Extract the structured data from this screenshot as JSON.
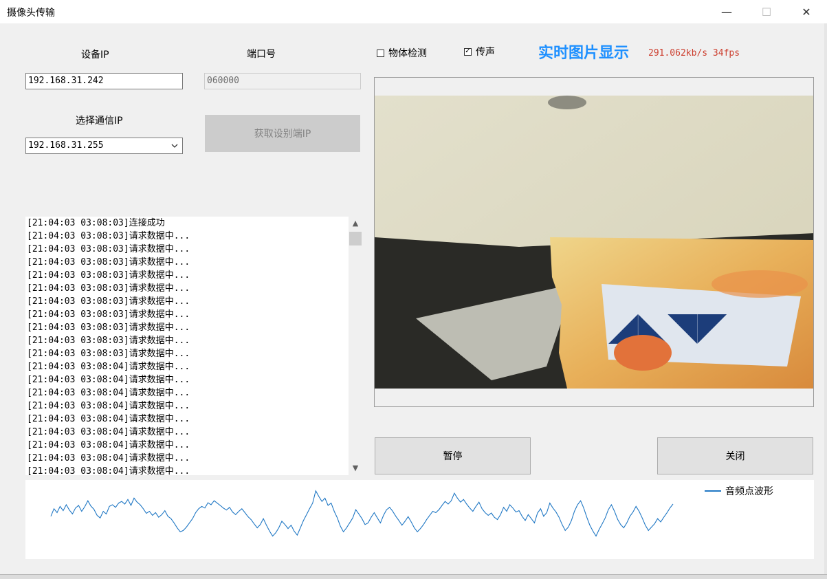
{
  "window": {
    "title": "摄像头传输",
    "minimize": "—",
    "maximize": "☐",
    "close": "✕"
  },
  "form": {
    "device_ip_label": "设备IP",
    "device_ip_value": "192.168.31.242",
    "port_label": "端口号",
    "port_value": "060000",
    "comm_ip_label": "选择通信IP",
    "comm_ip_value": "192.168.31.255",
    "get_ip_button": "获取设别端IP"
  },
  "options": {
    "object_detect_label": "物体检测",
    "object_detect_checked": false,
    "audio_label": "传声",
    "audio_checked": true
  },
  "display": {
    "title": "实时图片显示",
    "rate": "291.062kb/s 34fps"
  },
  "log": [
    "[21:04:03 03:08:03]连接成功",
    "[21:04:03 03:08:03]请求数据中...",
    "[21:04:03 03:08:03]请求数据中...",
    "[21:04:03 03:08:03]请求数据中...",
    "[21:04:03 03:08:03]请求数据中...",
    "[21:04:03 03:08:03]请求数据中...",
    "[21:04:03 03:08:03]请求数据中...",
    "[21:04:03 03:08:03]请求数据中...",
    "[21:04:03 03:08:03]请求数据中...",
    "[21:04:03 03:08:03]请求数据中...",
    "[21:04:03 03:08:03]请求数据中...",
    "[21:04:03 03:08:04]请求数据中...",
    "[21:04:03 03:08:04]请求数据中...",
    "[21:04:03 03:08:04]请求数据中...",
    "[21:04:03 03:08:04]请求数据中...",
    "[21:04:03 03:08:04]请求数据中...",
    "[21:04:03 03:08:04]请求数据中...",
    "[21:04:03 03:08:04]请求数据中...",
    "[21:04:03 03:08:04]请求数据中...",
    "[21:04:03 03:08:04]请求数据中..."
  ],
  "buttons": {
    "pause": "暂停",
    "close": "关闭"
  },
  "waveform": {
    "legend": "音频点波形",
    "color": "#1f77c4",
    "values": [
      0.15,
      0.38,
      0.26,
      0.45,
      0.32,
      0.5,
      0.34,
      0.22,
      0.4,
      0.48,
      0.3,
      0.44,
      0.62,
      0.46,
      0.36,
      0.18,
      0.1,
      0.3,
      0.22,
      0.45,
      0.5,
      0.42,
      0.55,
      0.6,
      0.52,
      0.66,
      0.48,
      0.7,
      0.58,
      0.5,
      0.38,
      0.24,
      0.3,
      0.18,
      0.26,
      0.12,
      0.2,
      0.32,
      0.15,
      0.08,
      -0.05,
      -0.2,
      -0.32,
      -0.28,
      -0.18,
      -0.05,
      0.08,
      0.26,
      0.38,
      0.45,
      0.4,
      0.56,
      0.5,
      0.62,
      0.55,
      0.48,
      0.4,
      0.34,
      0.42,
      0.28,
      0.2,
      0.3,
      0.38,
      0.26,
      0.14,
      0.05,
      -0.08,
      -0.2,
      -0.1,
      0.08,
      -0.12,
      -0.3,
      -0.45,
      -0.35,
      -0.2,
      0.0,
      -0.1,
      -0.22,
      -0.12,
      -0.3,
      -0.42,
      -0.2,
      0.02,
      0.2,
      0.38,
      0.55,
      0.92,
      0.75,
      0.6,
      0.7,
      0.48,
      0.55,
      0.3,
      0.1,
      -0.15,
      -0.32,
      -0.2,
      -0.05,
      0.1,
      0.35,
      0.22,
      0.08,
      -0.1,
      -0.05,
      0.12,
      0.26,
      0.1,
      -0.05,
      0.18,
      0.35,
      0.42,
      0.3,
      0.15,
      0.02,
      -0.12,
      0.0,
      0.14,
      -0.02,
      -0.2,
      -0.32,
      -0.22,
      -0.1,
      0.05,
      0.18,
      0.3,
      0.26,
      0.35,
      0.48,
      0.6,
      0.52,
      0.62,
      0.85,
      0.7,
      0.58,
      0.66,
      0.52,
      0.4,
      0.3,
      0.45,
      0.58,
      0.38,
      0.26,
      0.18,
      0.25,
      0.12,
      0.05,
      0.2,
      0.42,
      0.3,
      0.5,
      0.4,
      0.28,
      0.32,
      0.15,
      0.02,
      0.2,
      0.08,
      -0.05,
      0.25,
      0.38,
      0.15,
      0.26,
      0.55,
      0.4,
      0.28,
      0.12,
      -0.1,
      -0.28,
      -0.18,
      0.02,
      0.3,
      0.5,
      0.62,
      0.4,
      0.12,
      -0.12,
      -0.3,
      -0.45,
      -0.25,
      -0.08,
      0.1,
      0.35,
      0.5,
      0.3,
      0.06,
      -0.1,
      -0.2,
      -0.05,
      0.15,
      0.28,
      0.45,
      0.3,
      0.1,
      -0.12,
      -0.28,
      -0.18,
      -0.08,
      0.08,
      -0.02,
      0.12,
      0.25,
      0.4,
      0.52
    ]
  }
}
